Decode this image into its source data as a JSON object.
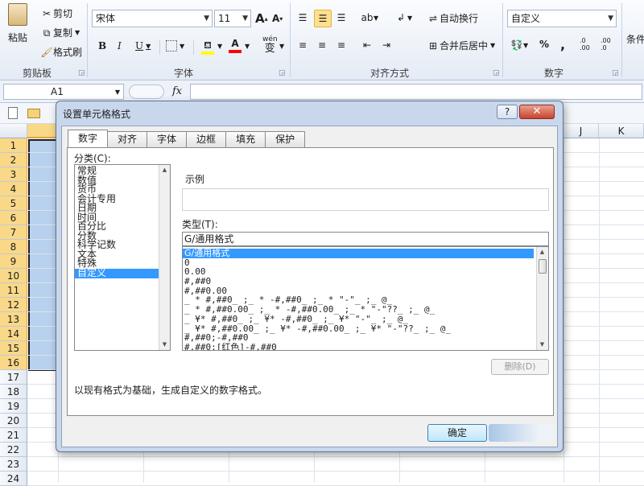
{
  "ribbon": {
    "clipboard": {
      "paste": "粘贴",
      "cut": "剪切",
      "copy": "复制",
      "format_painter": "格式刷",
      "group": "剪贴板"
    },
    "font": {
      "name": "宋体",
      "size": "11",
      "grow": "A",
      "shrink": "A",
      "bold": "B",
      "italic": "I",
      "underline": "U",
      "wen": "wén",
      "wen_char": "变",
      "fill_color": "#ffff00",
      "font_color": "#ff0000",
      "group": "字体"
    },
    "alignment": {
      "wrap": "自动换行",
      "merge": "合并后居中",
      "group": "对齐方式"
    },
    "number": {
      "format": "自定义",
      "percent": "%",
      "comma": ",",
      "inc_decimal": ".0\n.00",
      "dec_decimal": ".00\n.0",
      "group": "数字"
    },
    "conditional": "条件"
  },
  "formula_bar": {
    "cell_ref": "A1",
    "fx": "fx",
    "value": ""
  },
  "sheet": {
    "columns": [
      "J",
      "K"
    ],
    "rows": [
      "1",
      "2",
      "3",
      "4",
      "5",
      "6",
      "7",
      "8",
      "9",
      "10",
      "11",
      "12",
      "13",
      "14",
      "15",
      "16",
      "17",
      "18",
      "19",
      "20",
      "21",
      "22",
      "23",
      "24"
    ],
    "selected_rows": 16
  },
  "dialog": {
    "title": "设置单元格格式",
    "help": "?",
    "close": "✕",
    "tabs": [
      "数字",
      "对齐",
      "字体",
      "边框",
      "填充",
      "保护"
    ],
    "category_label": "分类(C):",
    "categories": [
      "常规",
      "数值",
      "货币",
      "会计专用",
      "日期",
      "时间",
      "百分比",
      "分数",
      "科学记数",
      "文本",
      "特殊",
      "自定义"
    ],
    "selected_category": "自定义",
    "sample_label": "示例",
    "type_label": "类型(T):",
    "type_value": "G/通用格式",
    "types": [
      "G/通用格式",
      "0",
      "0.00",
      "#,##0",
      "#,##0.00",
      "_ * #,##0_ ;_ * -#,##0_ ;_ * \"-\"_ ;_ @_",
      "_ * #,##0.00_ ;_ * -#,##0.00_ ;_ * \"-\"??_ ;_ @_",
      "_ ¥* #,##0_ ;_ ¥* -#,##0_ ;_ ¥* \"-\"_ ;_ @_",
      "_ ¥* #,##0.00_ ;_ ¥* -#,##0.00_ ;_ ¥* \"-\"??_ ;_ @_",
      "#,##0;-#,##0",
      "#,##0;[红色]-#,##0"
    ],
    "delete_button": "删除(D)",
    "description": "以现有格式为基础，生成自定义的数字格式。",
    "ok_button": "确定"
  }
}
